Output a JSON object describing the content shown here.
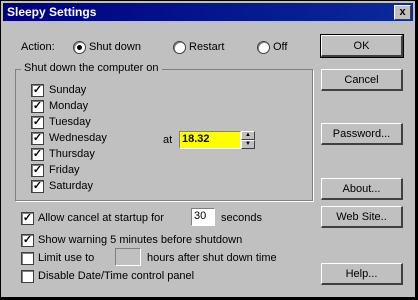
{
  "window": {
    "title": "Sleepy Settings",
    "close_glyph": "x"
  },
  "action": {
    "label": "Action:",
    "options": [
      {
        "label": "Shut down",
        "selected": true
      },
      {
        "label": "Restart",
        "selected": false
      },
      {
        "label": "Off",
        "selected": false
      }
    ]
  },
  "group": {
    "title": "Shut down the computer on",
    "days": [
      {
        "label": "Sunday",
        "checked": true
      },
      {
        "label": "Monday",
        "checked": true
      },
      {
        "label": "Tuesday",
        "checked": true
      },
      {
        "label": "Wednesday",
        "checked": true
      },
      {
        "label": "Thursday",
        "checked": true
      },
      {
        "label": "Friday",
        "checked": true
      },
      {
        "label": "Saturday",
        "checked": true
      }
    ],
    "at_label": "at",
    "time_value": "18.32"
  },
  "options": {
    "allow_cancel": {
      "label_before": "Allow cancel at startup for",
      "value": "30",
      "label_after": "seconds",
      "checked": true
    },
    "show_warning": {
      "label": "Show warning 5 minutes before shutdown",
      "checked": true
    },
    "limit_use": {
      "label_before": "Limit use to",
      "value": "",
      "label_after": "hours after shut down time",
      "checked": false
    },
    "disable_panel": {
      "label": "Disable Date/Time control panel",
      "checked": false
    }
  },
  "buttons": {
    "ok": "OK",
    "cancel": "Cancel",
    "password": "Password...",
    "about": "About...",
    "website": "Web Site..",
    "help": "Help..."
  },
  "check_glyph": "✓"
}
